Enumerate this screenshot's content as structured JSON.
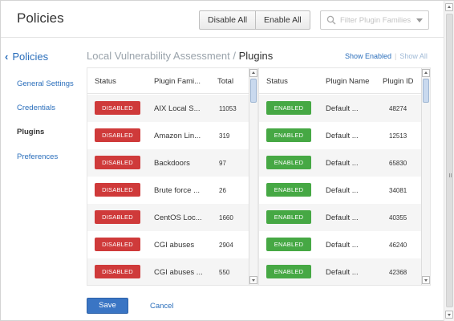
{
  "header": {
    "title": "Policies",
    "disable_all": "Disable All",
    "enable_all": "Enable All",
    "filter_placeholder": "Filter Plugin Families"
  },
  "nav": {
    "back_label": "Policies",
    "items": [
      {
        "label": "General Settings",
        "active": false
      },
      {
        "label": "Credentials",
        "active": false
      },
      {
        "label": "Plugins",
        "active": true
      },
      {
        "label": "Preferences",
        "active": false
      }
    ]
  },
  "section": {
    "parent": "Local Vulnerability Assessment",
    "separator": "/",
    "current": "Plugins",
    "show_enabled": "Show Enabled",
    "link_separator": "|",
    "show_all": "Show All"
  },
  "families_table": {
    "columns": [
      "Status",
      "Plugin Fami...",
      "Total"
    ],
    "rows": [
      {
        "status": "DISABLED",
        "family": "AIX Local S...",
        "total": "11053"
      },
      {
        "status": "DISABLED",
        "family": "Amazon Lin...",
        "total": "319"
      },
      {
        "status": "DISABLED",
        "family": "Backdoors",
        "total": "97"
      },
      {
        "status": "DISABLED",
        "family": "Brute force ...",
        "total": "26"
      },
      {
        "status": "DISABLED",
        "family": "CentOS Loc...",
        "total": "1660"
      },
      {
        "status": "DISABLED",
        "family": "CGI abuses",
        "total": "2904"
      },
      {
        "status": "DISABLED",
        "family": "CGI abuses ...",
        "total": "550"
      }
    ]
  },
  "plugins_table": {
    "columns": [
      "Status",
      "Plugin Name",
      "Plugin ID"
    ],
    "rows": [
      {
        "status": "ENABLED",
        "name": "Default ...",
        "id": "48274"
      },
      {
        "status": "ENABLED",
        "name": "Default ...",
        "id": "12513"
      },
      {
        "status": "ENABLED",
        "name": "Default ...",
        "id": "65830"
      },
      {
        "status": "ENABLED",
        "name": "Default ...",
        "id": "34081"
      },
      {
        "status": "ENABLED",
        "name": "Default ...",
        "id": "40355"
      },
      {
        "status": "ENABLED",
        "name": "Default ...",
        "id": "46240"
      },
      {
        "status": "ENABLED",
        "name": "Default ...",
        "id": "42368"
      }
    ]
  },
  "footer": {
    "save": "Save",
    "cancel": "Cancel"
  },
  "colors": {
    "link": "#2a6ebb",
    "disabled_badge": "#cf3a3a",
    "enabled_badge": "#46a844",
    "primary_button": "#3a75c4"
  }
}
